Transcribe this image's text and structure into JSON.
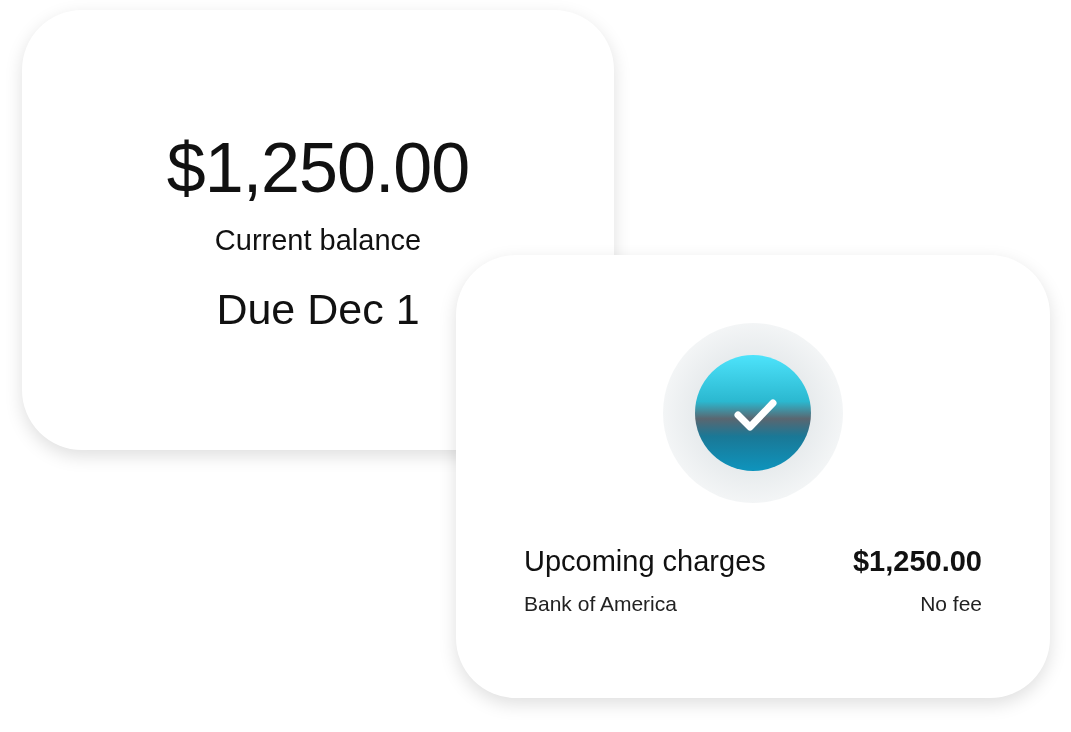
{
  "balance_card": {
    "amount": "$1,250.00",
    "label": "Current balance",
    "due": "Due Dec 1"
  },
  "charges_card": {
    "title": "Upcoming charges",
    "amount": "$1,250.00",
    "bank": "Bank of America",
    "fee": "No fee"
  }
}
